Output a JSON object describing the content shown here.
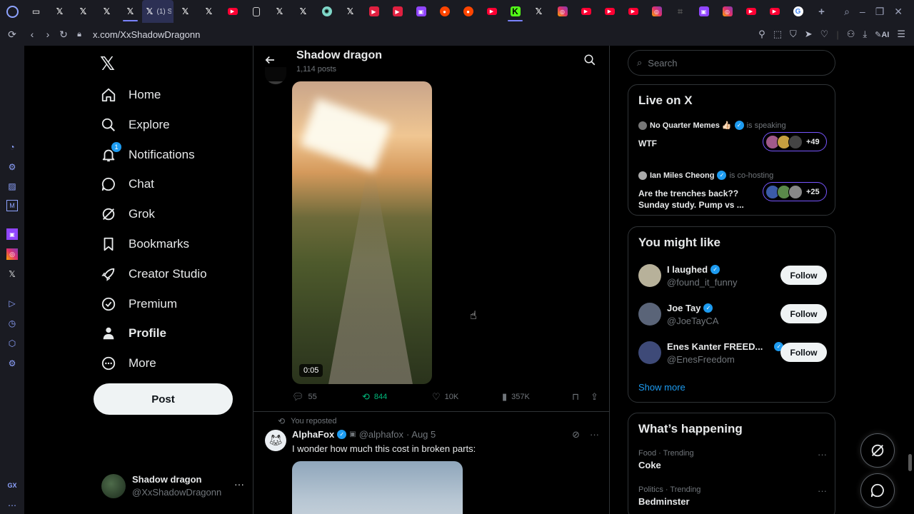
{
  "browser": {
    "address": "x.com/XxShadowDragonn",
    "active_tab_label": "(1) S",
    "tabs": [
      "game",
      "x",
      "x",
      "x",
      "x",
      "x-active",
      "x",
      "x",
      "youtube",
      "doc",
      "x",
      "x",
      "openai",
      "x",
      "media",
      "media",
      "twitch",
      "reddit",
      "reddit",
      "youtube",
      "kick",
      "x",
      "instagram",
      "youtube",
      "youtube",
      "youtube",
      "instagram",
      "ext",
      "twitch",
      "instagram",
      "youtube",
      "youtube",
      "google"
    ],
    "sidebar_badge": "GX",
    "colors": {
      "chrome_bg": "#1a1b22",
      "accent": "#8ea3ff"
    }
  },
  "nav": {
    "items": [
      {
        "label": "Home",
        "icon": "home-icon"
      },
      {
        "label": "Explore",
        "icon": "search-icon"
      },
      {
        "label": "Notifications",
        "icon": "bell-icon",
        "badge": "1"
      },
      {
        "label": "Chat",
        "icon": "chat-icon"
      },
      {
        "label": "Grok",
        "icon": "grok-icon"
      },
      {
        "label": "Bookmarks",
        "icon": "bookmark-icon"
      },
      {
        "label": "Creator Studio",
        "icon": "rocket-icon"
      },
      {
        "label": "Premium",
        "icon": "verified-icon"
      },
      {
        "label": "Profile",
        "icon": "person-icon"
      },
      {
        "label": "More",
        "icon": "more-circle-icon"
      }
    ],
    "post_label": "Post",
    "account": {
      "name": "Shadow dragon",
      "handle": "@XxShadowDragonn"
    }
  },
  "profile_header": {
    "title": "Shadow dragon",
    "subtitle": "1,114 posts"
  },
  "tweet1": {
    "video_time": "0:05",
    "replies": "55",
    "reposts": "844",
    "likes": "10K",
    "views": "357K"
  },
  "tweet2": {
    "repost_note": "You reposted",
    "name": "AlphaFox",
    "handle": "@alphafox",
    "date": "· Aug 5",
    "text": "I wonder how much this cost in broken parts:"
  },
  "search": {
    "placeholder": "Search"
  },
  "live": {
    "title": "Live on X",
    "rows": [
      {
        "host": "No Quarter Memes 👍🏻",
        "status": "is speaking",
        "topic": "WTF",
        "count": "+49"
      },
      {
        "host": "Ian Miles Cheong",
        "status": "is co-hosting",
        "topic": "Are the trenches back?? Sunday study.  Pump vs ...",
        "count": "+25"
      }
    ]
  },
  "might_like": {
    "title": "You might like",
    "users": [
      {
        "name": "I laughed",
        "handle": "@found_it_funny",
        "button": "Follow"
      },
      {
        "name": "Joe Tay",
        "handle": "@JoeTayCA",
        "button": "Follow"
      },
      {
        "name": "Enes Kanter FREED...",
        "handle": "@EnesFreedom",
        "button": "Follow"
      }
    ],
    "show_more": "Show more"
  },
  "happening": {
    "title": "What’s happening",
    "trends": [
      {
        "category": "Food · Trending",
        "name": "Coke"
      },
      {
        "category": "Politics · Trending",
        "name": "Bedminster"
      }
    ]
  }
}
